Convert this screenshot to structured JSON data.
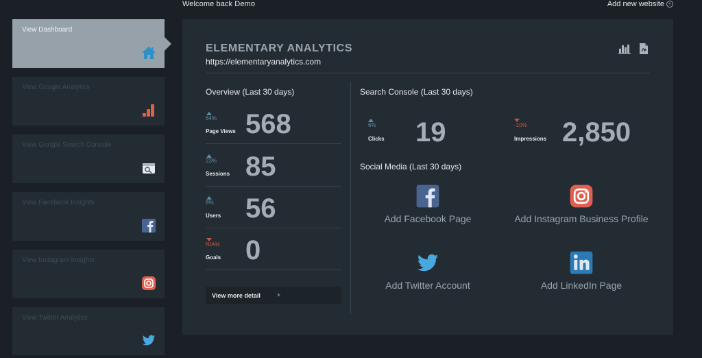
{
  "header": {
    "welcome": "Welcome back Demo",
    "add_website": "Add new website",
    "add_icon": "plus-circle-icon"
  },
  "sidebar": {
    "items": [
      {
        "label": "View Dashboard",
        "icon": "home-icon",
        "active": true
      },
      {
        "label": "View Google Analytics",
        "icon": "analytics-icon"
      },
      {
        "label": "View Google Search Console",
        "icon": "search-console-icon"
      },
      {
        "label": "View Facebook Insights",
        "icon": "facebook-icon"
      },
      {
        "label": "View Instagram Insights",
        "icon": "instagram-icon"
      },
      {
        "label": "View Twitter Analytics",
        "icon": "twitter-icon"
      }
    ]
  },
  "site": {
    "title": "ELEMENTARY ANALYTICS",
    "url": "https://elementaryanalytics.com"
  },
  "overview": {
    "title": "Overview (Last 30 days)",
    "metrics": [
      {
        "label": "Page Views",
        "value": "568",
        "delta": "64%",
        "direction": "up"
      },
      {
        "label": "Sessions",
        "value": "85",
        "delta": "23%",
        "direction": "up"
      },
      {
        "label": "Users",
        "value": "56",
        "delta": "8%",
        "direction": "up"
      },
      {
        "label": "Goals",
        "value": "0",
        "delta": "N/A%",
        "direction": "down"
      }
    ],
    "more_button": "View more detail"
  },
  "search_console": {
    "title": "Search Console (Last 30 days)",
    "metrics": [
      {
        "label": "Clicks",
        "value": "19",
        "delta": "6%",
        "direction": "up"
      },
      {
        "label": "Impressions",
        "value": "2,850",
        "delta": "-10%",
        "direction": "down"
      }
    ]
  },
  "social": {
    "title": "Social Media (Last 30 days)",
    "items": [
      {
        "label": "Add Facebook Page",
        "icon": "facebook-icon"
      },
      {
        "label": "Add Instagram Business Profile",
        "icon": "instagram-icon"
      },
      {
        "label": "Add Twitter Account",
        "icon": "twitter-icon"
      },
      {
        "label": "Add LinkedIn Page",
        "icon": "linkedin-icon"
      }
    ]
  },
  "colors": {
    "background": "#1a2026",
    "panel": "#242c33",
    "active_sidebar": "#96a1aa",
    "up": "#5a8ea3",
    "down": "#c0573f",
    "value_text": "#a4adb5"
  }
}
